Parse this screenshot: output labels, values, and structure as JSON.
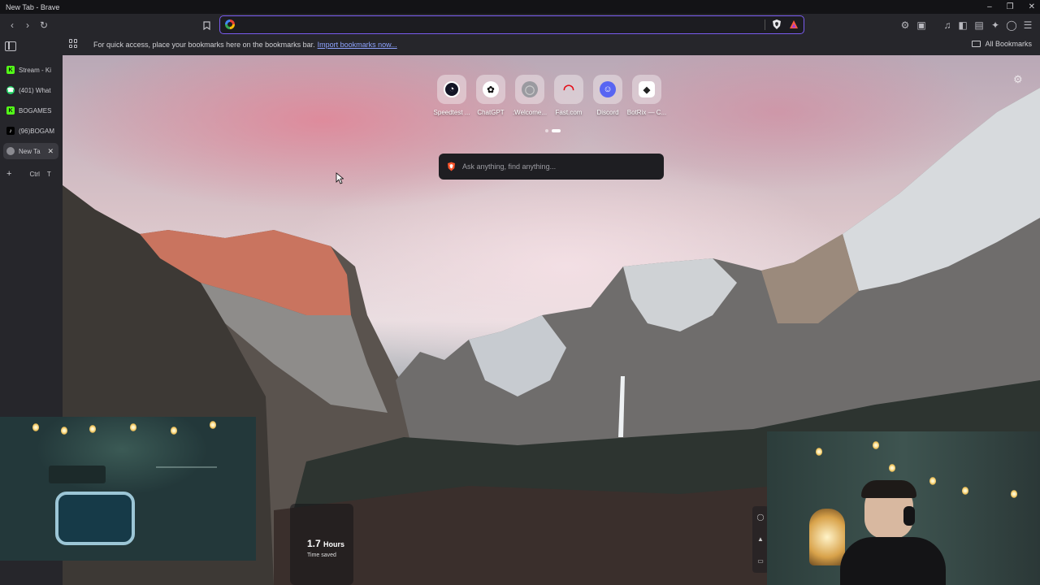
{
  "window": {
    "title": "New Tab - Brave"
  },
  "toolbar": {
    "url_value": "",
    "url_placeholder": ""
  },
  "bookmarks_bar": {
    "message": "For quick access, place your bookmarks here on the bookmarks bar.",
    "import_link": "Import bookmarks now...",
    "all_bookmarks": "All Bookmarks"
  },
  "tabs": [
    {
      "label": "Stream - Ki",
      "icon": "kick-icon",
      "color": "#53fc18",
      "active": false
    },
    {
      "label": "(401) What",
      "icon": "whatsapp-icon",
      "color": "#25d366",
      "active": false
    },
    {
      "label": "BOGAMES",
      "icon": "kick-icon",
      "color": "#53fc18",
      "active": false
    },
    {
      "label": "(96)BOGAM",
      "icon": "tiktok-icon",
      "color": "#000000",
      "active": false
    },
    {
      "label": "New Ta",
      "icon": "brave-icon",
      "color": "#8a8a90",
      "active": true
    }
  ],
  "new_tab": {
    "plus": "+",
    "shortcut_ctrl": "Ctrl",
    "shortcut_key": "T"
  },
  "top_sites": [
    {
      "label": "Speedtest ...",
      "icon": "speedtest-icon",
      "color": "#141526"
    },
    {
      "label": "ChatGPT",
      "icon": "chatgpt-icon",
      "color": "#ffffff"
    },
    {
      "label": ":Welcome...",
      "icon": "globe-icon",
      "color": "#9a9aa0"
    },
    {
      "label": "Fast.com",
      "icon": "fast-icon",
      "color": "#e50914"
    },
    {
      "label": "Discord",
      "icon": "discord-icon",
      "color": "#5865f2"
    },
    {
      "label": "BotRix — C...",
      "icon": "botrix-icon",
      "color": "#ffffff"
    }
  ],
  "search": {
    "placeholder": "Ask anything, find anything..."
  },
  "stats": {
    "value": "1.7",
    "unit": "Hours",
    "caption": "Time saved"
  },
  "colors": {
    "accent": "#7a5cf0",
    "link": "#8ea3ff",
    "chrome_bg": "#26262b"
  }
}
